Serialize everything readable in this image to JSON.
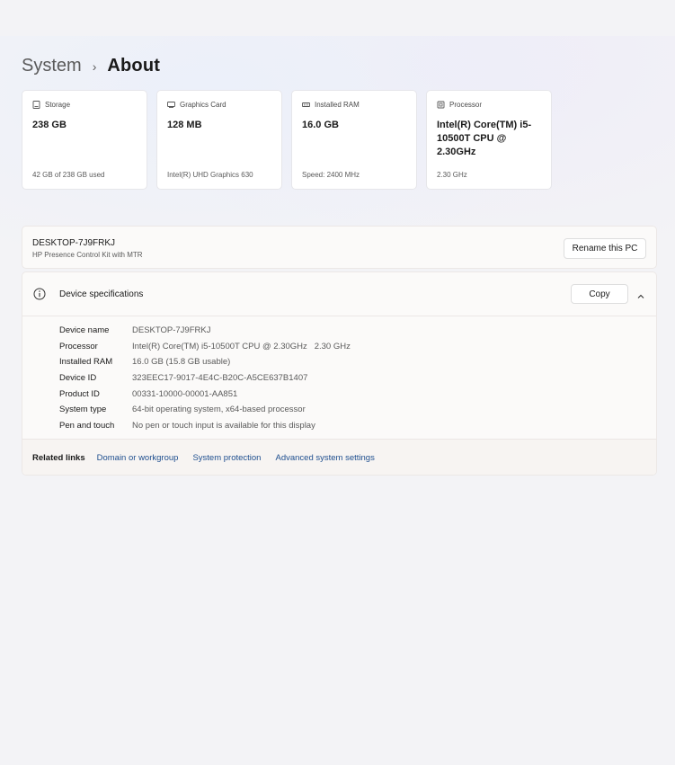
{
  "breadcrumb": {
    "parent": "System",
    "separator": "›",
    "current": "About"
  },
  "cards": [
    {
      "icon": "storage-icon",
      "label": "Storage",
      "value": "238 GB",
      "sub": "42 GB of 238 GB used"
    },
    {
      "icon": "graphics-card-icon",
      "label": "Graphics Card",
      "value": "128 MB",
      "sub": "Intel(R) UHD Graphics 630"
    },
    {
      "icon": "ram-icon",
      "label": "Installed RAM",
      "value": "16.0 GB",
      "sub": "Speed: 2400 MHz"
    },
    {
      "icon": "processor-icon",
      "label": "Processor",
      "value": "Intel(R) Core(TM) i5-10500T CPU @ 2.30GHz",
      "sub": "2.30 GHz"
    }
  ],
  "pc": {
    "name": "DESKTOP-7J9FRKJ",
    "model": "HP Presence Control Kit with MTR",
    "rename_label": "Rename this PC"
  },
  "specs": {
    "title": "Device specifications",
    "copy_label": "Copy",
    "rows": [
      {
        "label": "Device name",
        "value": "DESKTOP-7J9FRKJ"
      },
      {
        "label": "Processor",
        "value": "Intel(R) Core(TM) i5-10500T CPU @ 2.30GHz   2.30 GHz"
      },
      {
        "label": "Installed RAM",
        "value": "16.0 GB (15.8 GB usable)"
      },
      {
        "label": "Device ID",
        "value": "323EEC17-9017-4E4C-B20C-A5CE637B1407"
      },
      {
        "label": "Product ID",
        "value": "00331-10000-00001-AA851"
      },
      {
        "label": "System type",
        "value": "64-bit operating system, x64-based processor"
      },
      {
        "label": "Pen and touch",
        "value": "No pen or touch input is available for this display"
      }
    ]
  },
  "related": {
    "title": "Related links",
    "links": [
      "Domain or workgroup",
      "System protection",
      "Advanced system settings"
    ]
  }
}
